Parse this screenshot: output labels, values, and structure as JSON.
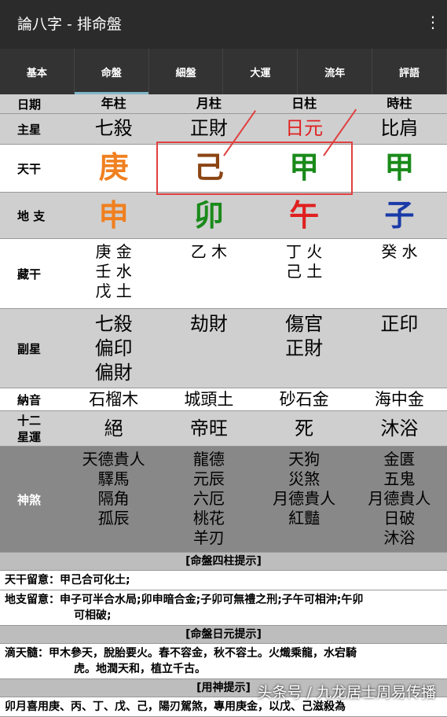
{
  "app": {
    "title": "論八字 - 排命盤",
    "menu_icon": "⋮"
  },
  "tabs": [
    {
      "label": "基本"
    },
    {
      "label": "命盤",
      "active": true
    },
    {
      "label": "細盤"
    },
    {
      "label": "大運"
    },
    {
      "label": "流年"
    },
    {
      "label": "評語"
    }
  ],
  "header": {
    "label": "日期",
    "cols": [
      "年柱",
      "月柱",
      "日柱",
      "時柱"
    ]
  },
  "rows": {
    "main_star": {
      "label": "主星",
      "cols": [
        "七殺",
        "正財",
        "日元",
        "比肩"
      ],
      "colors": [
        "#000",
        "#000",
        "#e02020",
        "#000"
      ]
    },
    "tiangan": {
      "label": "天干",
      "cols": [
        "庚",
        "己",
        "甲",
        "甲"
      ],
      "colors": [
        "#f08020",
        "#8b4513",
        "#1a8a1a",
        "#1a8a1a"
      ]
    },
    "dizhi": {
      "label": "地 支",
      "cols": [
        "申",
        "卯",
        "午",
        "子"
      ],
      "colors": [
        "#f08020",
        "#1a8a1a",
        "#e02020",
        "#1a3aa8"
      ]
    },
    "canggan": {
      "label": "藏干",
      "cols": [
        [
          "庚 金",
          "壬 水",
          "戊 土"
        ],
        [
          "乙 木"
        ],
        [
          "丁 火",
          "己 土"
        ],
        [
          "癸 水"
        ]
      ]
    },
    "fuxing": {
      "label": "副星",
      "cols": [
        [
          "七殺",
          "偏印",
          "偏財"
        ],
        [
          "劫財"
        ],
        [
          "傷官",
          "正財"
        ],
        [
          "正印"
        ]
      ]
    },
    "nayin": {
      "label": "納音",
      "cols": [
        "石榴木",
        "城頭土",
        "砂石金",
        "海中金"
      ]
    },
    "xingyun": {
      "label": "十二\n星運",
      "cols": [
        "絕",
        "帝旺",
        "死",
        "沐浴"
      ]
    },
    "shensha": {
      "label": "神煞",
      "cols": [
        [
          "天德貴人",
          "驛馬",
          "隔角",
          "孤辰"
        ],
        [
          "龍德",
          "元辰",
          "六厄",
          "桃花",
          "羊刃"
        ],
        [
          "天狗",
          "災煞",
          "月德貴人",
          "紅豔"
        ],
        [
          "金匱",
          "五鬼",
          "月德貴人",
          "日破",
          "沐浴"
        ]
      ]
    }
  },
  "sections": {
    "pillars_hint": "[命盤四柱提示]",
    "tiangan_note_label": "天干留意：",
    "tiangan_note": "甲己合可化土;",
    "dizhi_note_label": "地支留意：",
    "dizhi_note": "申子可半合水局;卯申暗合金;子卯可無禮之刑;子午可相沖;午卯",
    "dizhi_note_2": "可相破;",
    "dayuan_hint": "[命盤日元提示]",
    "ditian_label": "滴天髓：",
    "ditian": "甲木參天，脫胎要火。春不容金，秋不容土。火熾乘龍，水宕騎",
    "ditian_2": "虎。地潤天和，植立千古。",
    "yongshen_hint": "[用神提示]",
    "bottom_cut": "卯月喜用庚、丙、丁、戊、己，陽刃駕煞，專用庚金，以戊、己滋殺為"
  },
  "watermark": "头条号 / 九龙居士周易传播"
}
